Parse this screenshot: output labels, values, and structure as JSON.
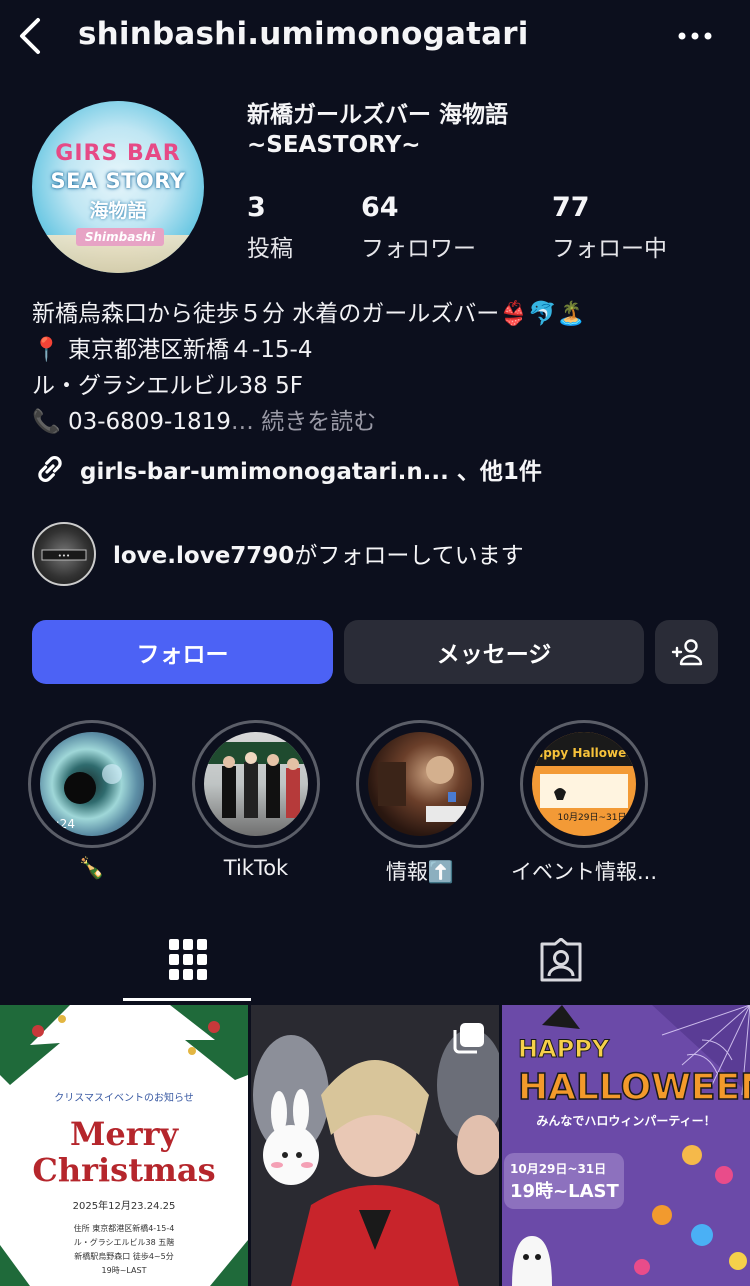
{
  "header": {
    "username": "shinbashi.umimonogatari"
  },
  "profile": {
    "avatar_text": [
      "GIRS BAR",
      "SEA STORY",
      "海物語",
      "Shimbashi"
    ],
    "display_name_line1": "新橋ガールズバー 海物語",
    "display_name_line2": "~SEASTORY~",
    "stats": [
      {
        "value": "3",
        "label": "投稿"
      },
      {
        "value": "64",
        "label": "フォロワー"
      },
      {
        "value": "77",
        "label": "フォロー中"
      }
    ]
  },
  "bio": {
    "line1": "新橋烏森口から徒歩５分 水着のガールズバー👙🐬🏝️",
    "line2": "📍 東京都港区新橋４-15-4",
    "line3": "ル・グラシエルビル38 5F",
    "line4": "📞 03-6809-1819",
    "more": "… 続きを読む",
    "link": "girls-bar-umimonogatari.n... 、他1件"
  },
  "followed_by": {
    "user": "love.love7790",
    "text": "がフォローしています"
  },
  "actions": {
    "follow": "フォロー",
    "message": "メッセージ"
  },
  "highlights": [
    {
      "label": "🍾"
    },
    {
      "label": "TikTok"
    },
    {
      "label": "情報⬆️"
    },
    {
      "label": "イベント情報..."
    }
  ],
  "highlight_texts": {
    "h1_time": "0:24",
    "h4_title": "Happy Halloween",
    "h4_date": "10月29日~31日"
  },
  "posts": {
    "p1": {
      "subtitle": "クリスマスイベントのお知らせ",
      "title1": "Merry",
      "title2": "Christmas",
      "date": "2025年12月23.24.25",
      "info1": "住所 東京都港区新橋4-15-4",
      "info2": "ル・グラシエルビル38 五階",
      "info3": "新橋駅烏野森口 徒歩4~5分",
      "info4": "19時~LAST"
    },
    "p3": {
      "title1": "HAPPY",
      "title2": "HALLOWEEN",
      "sub": "みんなでハロウィンパーティー！",
      "date": "10月29日~31日",
      "time": "19時~LAST"
    }
  },
  "colors": {
    "background": "#0c0f1d",
    "follow_button": "#4c62f5",
    "secondary_button": "#2a2c37",
    "muted_text": "#9a9aa6"
  },
  "icons": [
    "chevron-left-icon",
    "more-icon",
    "link-icon",
    "person-add-icon",
    "grid-icon",
    "tagged-icon",
    "multi-post-icon"
  ]
}
